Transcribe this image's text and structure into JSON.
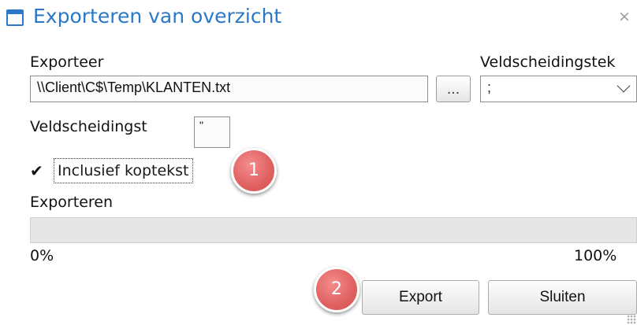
{
  "dialog": {
    "title": "Exporteren van overzicht",
    "close_glyph": "×",
    "title_icon": "window-icon"
  },
  "export_to": {
    "label": "Exporteer",
    "value": "\\\\Client\\C$\\Temp\\KLANTEN.txt",
    "browse_label": "..."
  },
  "field_separator": {
    "label": "Veldscheidingstek",
    "selected": ";"
  },
  "text_qualifier": {
    "label": "Veldscheidingst",
    "value": "\""
  },
  "include_header": {
    "label": "Inclusief koptekst",
    "checked": true,
    "check_glyph": "✔"
  },
  "progress": {
    "label": "Exporteren",
    "value": 0,
    "min_label": "0%",
    "max_label": "100%",
    "fill_color": "#3c9a3c"
  },
  "buttons": {
    "export_label": "Export",
    "close_label": "Sluiten"
  },
  "callouts": {
    "one": "1",
    "two": "2",
    "color": "#e06060"
  },
  "accent_color": "#2a78c7"
}
